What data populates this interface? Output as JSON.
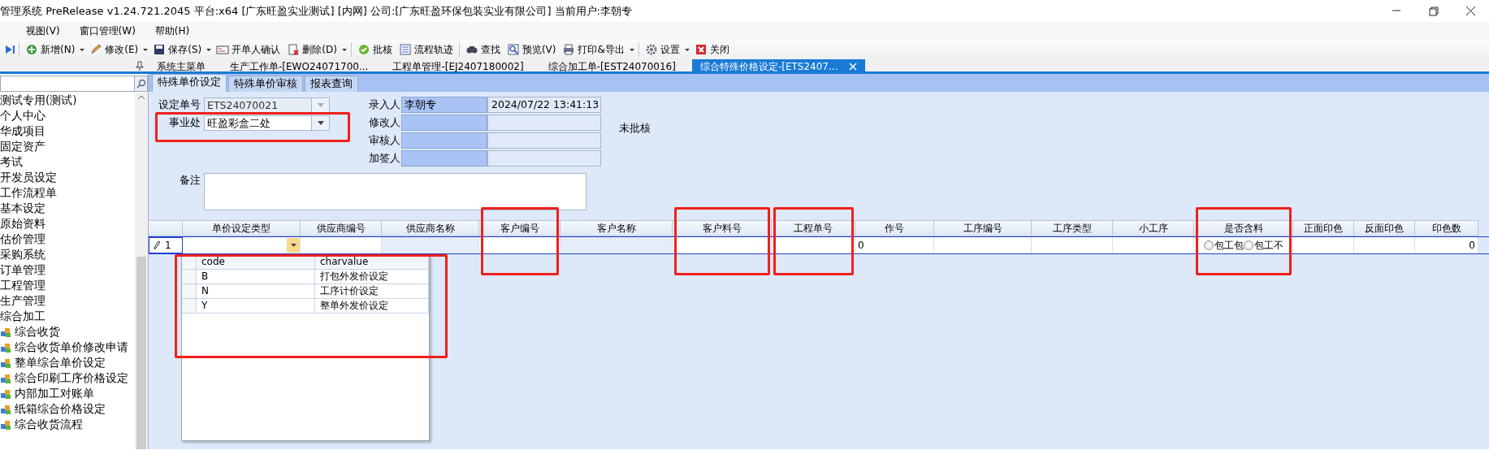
{
  "window": {
    "title": "管理系统 PreRelease v1.24.721.2045 平台:x64  [广东旺盈实业测试] [内网] 公司:[广东旺盈环保包装实业有限公司] 当前用户:李朝专"
  },
  "menu": [
    "视图(V)",
    "窗口管理(W)",
    "帮助(H)"
  ],
  "toolbar": [
    {
      "kind": "icon"
    },
    {
      "kind": "separator"
    },
    {
      "kind": "button",
      "label": "新增(N)",
      "dropdown": true
    },
    {
      "kind": "button",
      "label": "修改(E)",
      "dropdown": true
    },
    {
      "kind": "button",
      "label": "保存(S)",
      "dropdown": true
    },
    {
      "kind": "button",
      "label": "开单人确认",
      "dropdown": false
    },
    {
      "kind": "button",
      "label": "删除(D)",
      "dropdown": true
    },
    {
      "kind": "separator"
    },
    {
      "kind": "button",
      "label": "批核",
      "dropdown": false
    },
    {
      "kind": "button",
      "label": "流程轨迹",
      "dropdown": false
    },
    {
      "kind": "separator"
    },
    {
      "kind": "button",
      "label": "查找",
      "dropdown": false
    },
    {
      "kind": "button",
      "label": "预览(V)",
      "dropdown": false
    },
    {
      "kind": "button",
      "label": "打印&导出",
      "dropdown": true
    },
    {
      "kind": "separator"
    },
    {
      "kind": "button",
      "label": "设置",
      "dropdown": true
    },
    {
      "kind": "button",
      "label": "关闭",
      "dropdown": false
    }
  ],
  "doc_tabs": [
    {
      "label": "系统主菜单",
      "selected": false
    },
    {
      "label": "生产工作单-[EWO24071700...",
      "selected": false
    },
    {
      "label": "工程单管理-[EJ2407180002]",
      "selected": false
    },
    {
      "label": "综合加工单-[EST24070016]",
      "selected": false
    },
    {
      "label": "综合特殊价格设定-[ETS2407...",
      "selected": true
    }
  ],
  "sidebar": {
    "items": [
      {
        "label": "测试专用(测试)"
      },
      {
        "label": "个人中心"
      },
      {
        "label": "华成项目"
      },
      {
        "label": "固定资产"
      },
      {
        "label": "考试"
      },
      {
        "label": "开发员设定"
      },
      {
        "label": "工作流程单"
      },
      {
        "label": "基本设定"
      },
      {
        "label": "原始资料"
      },
      {
        "label": "估价管理"
      },
      {
        "label": "采购系统"
      },
      {
        "label": "订单管理"
      },
      {
        "label": "工程管理"
      },
      {
        "label": "生产管理"
      },
      {
        "label": "综合加工",
        "children": [
          {
            "label": "综合收货"
          },
          {
            "label": "综合收货单价修改申请"
          },
          {
            "label": "整单综合单价设定"
          },
          {
            "label": "综合印刷工序价格设定"
          },
          {
            "label": "内部加工对账单"
          },
          {
            "label": "纸箱综合价格设定"
          },
          {
            "label": "综合收货流程"
          }
        ]
      }
    ]
  },
  "form": {
    "tabs": [
      {
        "label": "特殊单价设定",
        "selected": true
      },
      {
        "label": "特殊单价审核",
        "selected": false
      },
      {
        "label": "报表查询",
        "selected": false
      }
    ],
    "doc_no": {
      "label": "设定单号",
      "value": "ETS24070021",
      "disabled": true
    },
    "business_unit": {
      "label": "事业处",
      "value": "旺盈彩盒二处",
      "disabled": false
    },
    "people": [
      {
        "label": "录入人",
        "name": "李朝专",
        "time": "2024/07/22 13:41:13"
      },
      {
        "label": "修改人"
      },
      {
        "label": "审核人"
      },
      {
        "label": "加签人"
      }
    ],
    "status": "未批核",
    "remark": {
      "label": "备注"
    }
  },
  "grid": {
    "columns": [
      {
        "label": "单价设定类型",
        "kind": "dropdown"
      },
      {
        "label": "供应商编号",
        "kind": "text"
      },
      {
        "label": "供应商名称",
        "kind": "readonly"
      },
      {
        "label": "客户编号",
        "kind": "text"
      },
      {
        "label": "客户名称",
        "kind": "readonly"
      },
      {
        "label": "客户料号",
        "kind": "text"
      },
      {
        "label": "工程单号",
        "kind": "text"
      },
      {
        "label": "作号",
        "kind": "text"
      },
      {
        "label": "工序编号",
        "kind": "text"
      },
      {
        "label": "工序类型",
        "kind": "text"
      },
      {
        "label": "小工序",
        "kind": "text"
      },
      {
        "label": "是否含料",
        "kind": "radio"
      },
      {
        "label": "正面印色",
        "kind": "text"
      },
      {
        "label": "反面印色",
        "kind": "text"
      },
      {
        "label": "印色数",
        "kind": "number"
      }
    ],
    "rows": [
      {
        "number": "1",
        "editing": true,
        "cells": [
          null,
          null,
          null,
          null,
          null,
          null,
          null,
          "0",
          null,
          null,
          null,
          [
            {
              "label": "包工包",
              "checked": false
            },
            {
              "label": "包工不",
              "checked": false
            }
          ],
          null,
          null,
          "0"
        ]
      }
    ],
    "popup": {
      "columns": [
        "code",
        "charvalue"
      ],
      "rows": [
        [
          "B",
          "打包外发价设定"
        ],
        [
          "N",
          "工序计价设定"
        ],
        [
          "Y",
          "整单外发价设定"
        ]
      ]
    }
  },
  "highlights": [
    {
      "kind": "box"
    },
    {
      "kind": "box"
    },
    {
      "kind": "box"
    },
    {
      "kind": "box"
    },
    {
      "kind": "box"
    },
    {
      "kind": "box"
    }
  ]
}
